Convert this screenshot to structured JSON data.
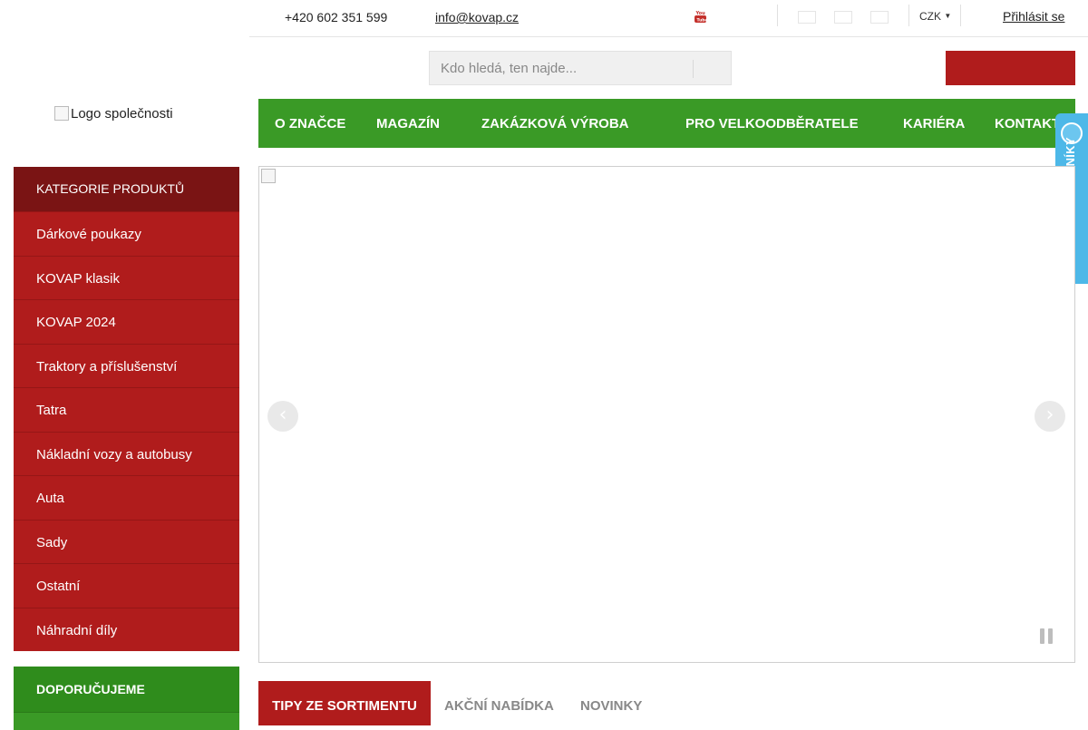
{
  "topbar": {
    "phone": "+420 602 351 599",
    "email": "info@kovap.cz",
    "youtube_icon": "youtube-icon",
    "currency": "CZK",
    "login": "Přihlásit se"
  },
  "search": {
    "placeholder": "Kdo hledá, ten najde..."
  },
  "logo": {
    "alt": "Logo společnosti"
  },
  "nav": {
    "items": [
      {
        "label": "O ZNAČCE"
      },
      {
        "label": "MAGAZÍN"
      },
      {
        "label": "ZAKÁZKOVÁ VÝROBA"
      },
      {
        "label": "PRO VELKOODBĚRATELE"
      },
      {
        "label": "KARIÉRA"
      },
      {
        "label": "KONTAKT"
      }
    ]
  },
  "badge": {
    "label": "OVĚŘENO ZÁKAZNÍKY"
  },
  "categories": {
    "title": "KATEGORIE PRODUKTŮ",
    "items": [
      {
        "label": "Dárkové poukazy"
      },
      {
        "label": "KOVAP klasik"
      },
      {
        "label": "KOVAP 2024"
      },
      {
        "label": "Traktory a příslušenství"
      },
      {
        "label": "Tatra"
      },
      {
        "label": "Nákladní vozy a autobusy"
      },
      {
        "label": "Auta"
      },
      {
        "label": "Sady"
      },
      {
        "label": "Ostatní"
      },
      {
        "label": "Náhradní díly"
      }
    ]
  },
  "recommended": {
    "title": "DOPORUČUJEME"
  },
  "tabs": [
    {
      "label": "TIPY ZE SORTIMENTU",
      "active": true
    },
    {
      "label": "AKČNÍ NABÍDKA",
      "active": false
    },
    {
      "label": "NOVINKY",
      "active": false
    }
  ],
  "colors": {
    "brand_red": "#b01c1c",
    "dark_red": "#7a1414",
    "brand_green": "#3a9a26",
    "badge_blue": "#4db8e8"
  }
}
